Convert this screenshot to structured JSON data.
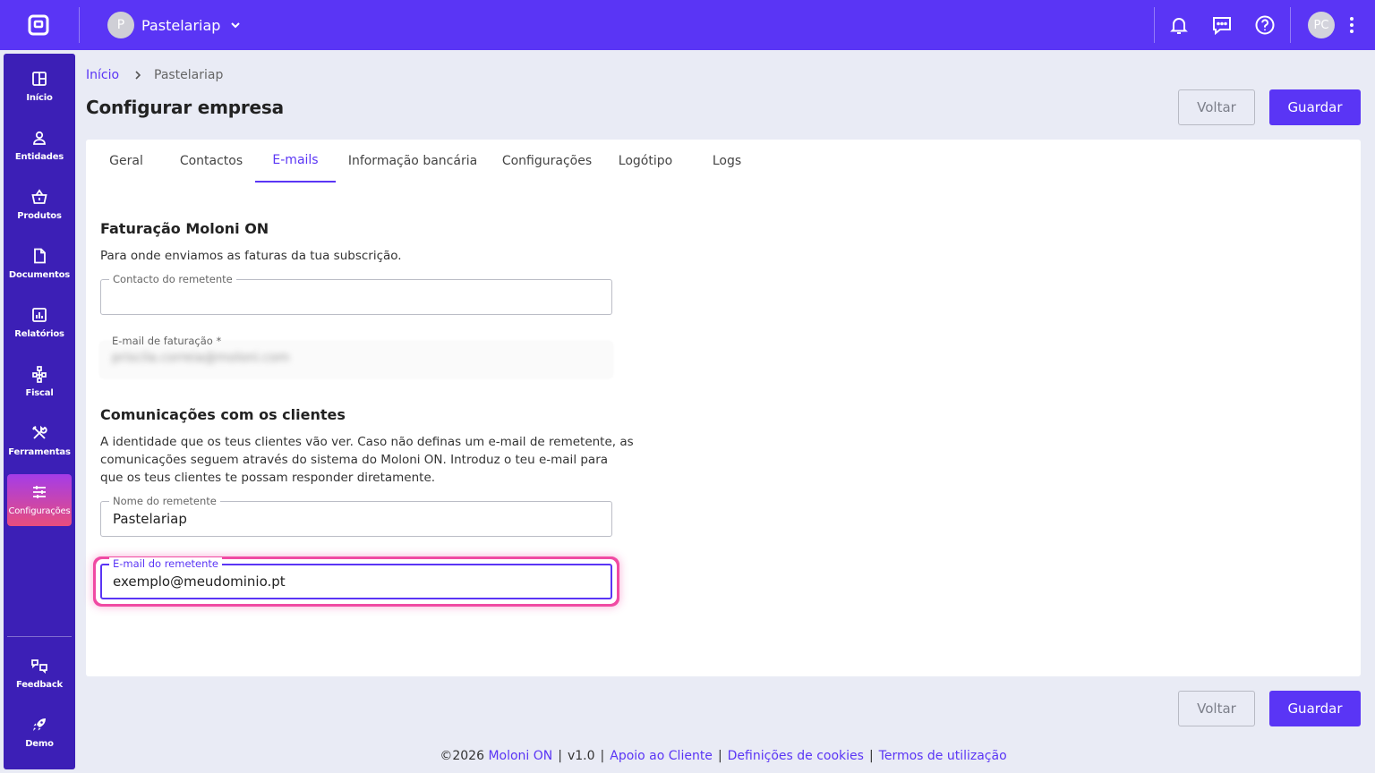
{
  "topbar": {
    "company_initial": "P",
    "company_name": "Pastelariap",
    "user_initials": "PC"
  },
  "sidebar": {
    "items": [
      {
        "label": "Início",
        "icon": "dashboard-icon"
      },
      {
        "label": "Entidades",
        "icon": "user-icon"
      },
      {
        "label": "Produtos",
        "icon": "basket-icon"
      },
      {
        "label": "Documentos",
        "icon": "document-icon"
      },
      {
        "label": "Relatórios",
        "icon": "chart-icon"
      },
      {
        "label": "Fiscal",
        "icon": "network-icon"
      },
      {
        "label": "Ferramentas",
        "icon": "tools-icon"
      },
      {
        "label": "Configurações",
        "icon": "sliders-icon"
      }
    ],
    "bottom": [
      {
        "label": "Feedback",
        "icon": "feedback-icon"
      },
      {
        "label": "Demo",
        "icon": "rocket-icon"
      }
    ],
    "active": "Configurações"
  },
  "breadcrumb": {
    "home": "Início",
    "current": "Pastelariap"
  },
  "page": {
    "title": "Configurar empresa",
    "back_label": "Voltar",
    "save_label": "Guardar"
  },
  "tabs": [
    "Geral",
    "Contactos",
    "E-mails",
    "Informação bancária",
    "Configurações",
    "Logótipo",
    "Logs"
  ],
  "active_tab": "E-mails",
  "billing": {
    "title": "Faturação Moloni ON",
    "description": "Para onde enviamos as faturas da tua subscrição.",
    "sender_contact_label": "Contacto do remetente",
    "sender_contact_value": "",
    "billing_email_label": "E-mail de faturação *",
    "billing_email_value": "priscila.correia@moloni.com"
  },
  "communications": {
    "title": "Comunicações com os clientes",
    "description_line1": "A identidade que os teus clientes vão ver. Caso não definas um e-mail de remetente, as",
    "description_line2": "comunicações seguem através do sistema do Moloni ON. Introduz o teu e-mail para",
    "description_line3": "que os teus clientes te possam responder diretamente.",
    "sender_name_label": "Nome do remetente",
    "sender_name_value": "Pastelariap",
    "sender_email_label": "E-mail do remetente",
    "sender_email_value": "exemplo@meudominio.pt"
  },
  "footer": {
    "copyright": "©2026",
    "brand": "Moloni ON",
    "version": "v1.0",
    "support": "Apoio ao Cliente",
    "cookies": "Definições de cookies",
    "terms": "Termos de utilização"
  },
  "colors": {
    "primary": "#5a35f5",
    "sidebar": "#3c1fb6",
    "background": "#e9ebf5",
    "focus_ring": "#f04aa3"
  }
}
